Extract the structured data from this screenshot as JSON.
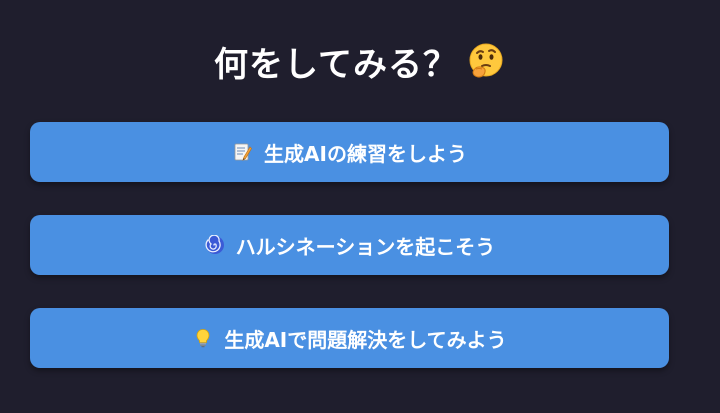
{
  "title": {
    "text": "何をしてみる？",
    "emoji_icon": "thinking-face-icon"
  },
  "options": [
    {
      "icon": "memo-icon",
      "label": "生成AIの練習をしよう"
    },
    {
      "icon": "cyclone-icon",
      "label": "ハルシネーションを起こそう"
    },
    {
      "icon": "light-bulb-icon",
      "label": "生成AIで問題解決をしてみよう"
    }
  ],
  "colors": {
    "background": "#1f1e2d",
    "button": "#4a90e2",
    "text": "#ffffff"
  }
}
